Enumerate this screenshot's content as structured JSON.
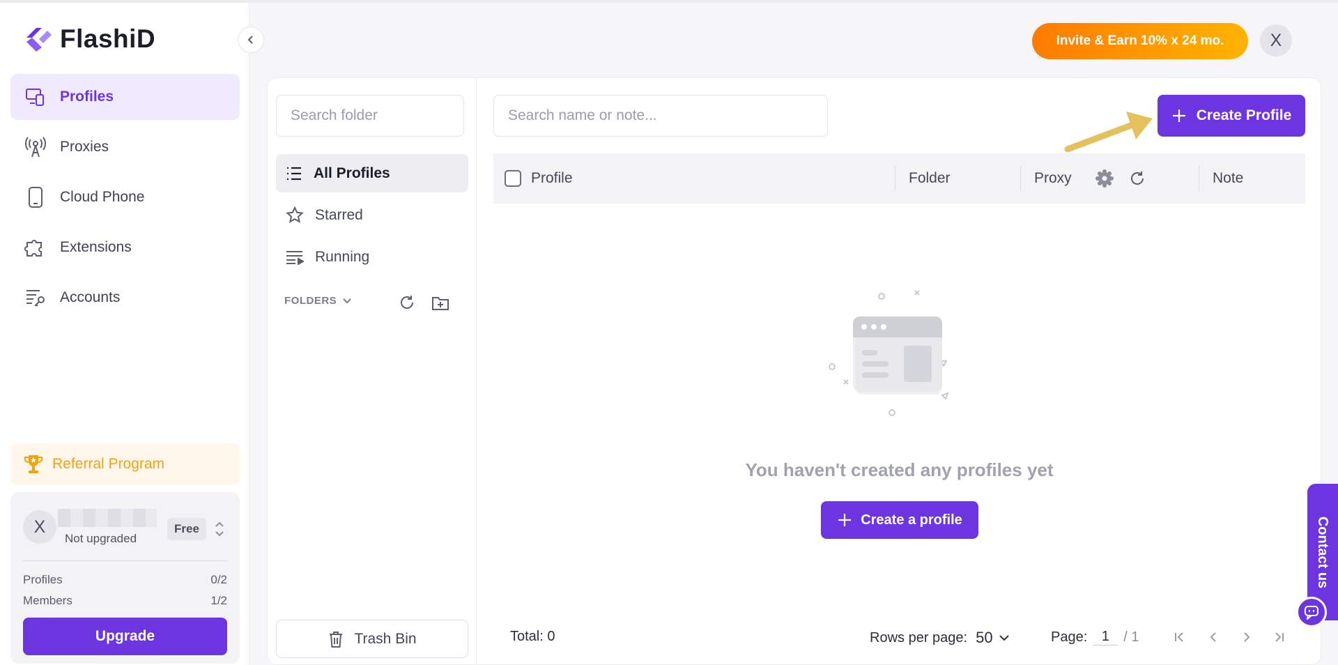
{
  "app": {
    "name": "FlashiD"
  },
  "sidebar": {
    "items": [
      {
        "label": "Profiles",
        "icon": "profiles-icon",
        "active": true
      },
      {
        "label": "Proxies",
        "icon": "proxies-icon"
      },
      {
        "label": "Cloud Phone",
        "icon": "phone-icon"
      },
      {
        "label": "Extensions",
        "icon": "puzzle-icon"
      },
      {
        "label": "Accounts",
        "icon": "accounts-icon"
      }
    ],
    "referral": "Referral Program",
    "account": {
      "avatar_letter": "X",
      "status": "Not upgraded",
      "plan": "Free",
      "profiles_label": "Profiles",
      "profiles_value": "0/2",
      "members_label": "Members",
      "members_value": "1/2",
      "upgrade_label": "Upgrade"
    }
  },
  "header": {
    "invite_label": "Invite & Earn 10% x 24 mo.",
    "avatar_letter": "X"
  },
  "folders": {
    "search_placeholder": "Search folder",
    "items": [
      {
        "label": "All Profiles",
        "active": true
      },
      {
        "label": "Starred"
      },
      {
        "label": "Running"
      }
    ],
    "section_label": "FOLDERS",
    "trash_label": "Trash Bin"
  },
  "profiles": {
    "search_placeholder": "Search name or note...",
    "create_label": "Create Profile",
    "columns": {
      "profile": "Profile",
      "folder": "Folder",
      "proxy": "Proxy",
      "note": "Note"
    },
    "empty_text": "You haven't created any profiles yet",
    "empty_button": "Create a profile",
    "total_label": "Total: 0",
    "rows_per_page_label": "Rows per page:",
    "rows_per_page_value": "50",
    "page_label": "Page:",
    "page_value": "1",
    "page_total": "/ 1"
  },
  "contact": {
    "label": "Contact us"
  },
  "colors": {
    "accent": "#6d35e0",
    "invite_gradient_start": "#ff7a00",
    "invite_gradient_end": "#ffb300",
    "referral": "#f5a20c"
  }
}
